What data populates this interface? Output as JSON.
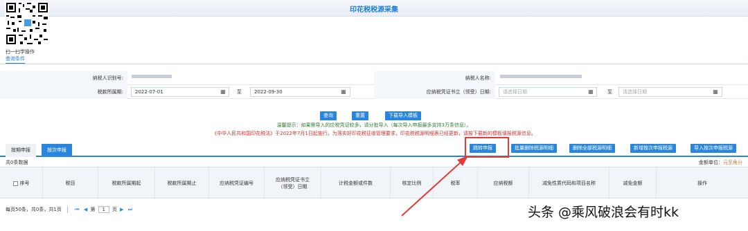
{
  "header": {
    "title": "印花税税源采集"
  },
  "qr": {
    "label": "扫一扫学操作"
  },
  "query": {
    "section_tab": "查询条件",
    "taxpayer_id_label": "纳税人识别号:",
    "taxpayer_name_label": "纳税人名称:",
    "period_label": "税款所属期:",
    "period_start": "2022-07-01",
    "period_end": "2022-09-30",
    "to": "至",
    "voucher_date_label": "应纳税凭证书立（领受）日期:",
    "date_placeholder": "请选择日期"
  },
  "actions": {
    "query": "查询",
    "reset": "重置",
    "download_template": "下载导入模板"
  },
  "tips": {
    "line1": "温馨提示：如果需导入的应税凭证较多，请分批导入（每次导入申报最多支持3万条信息）。",
    "line2": "《中华人民共和国印花税法》于2022年7月1日起施行。为落实好印花税征收管理要求，印花税税源明细表已经更新，请按下载新的模板填报税源信息。"
  },
  "tabs": {
    "by_period": "按期申报",
    "by_item": "按次申报"
  },
  "toolbar": {
    "jump": "跳转申报",
    "batch_delete": "批量删除税源明细",
    "delete_all": "删除全部税源明细",
    "add_item": "新增按次申报税源",
    "import_item": "导入按次申报税源"
  },
  "table": {
    "count": "共0条数据",
    "unit_label": "金额单位：",
    "unit_value": "元至角分",
    "columns": [
      "序号",
      "税目",
      "税款所属期起",
      "税款所属期止",
      "应纳税凭证编号",
      "应纳税凭证书立（领受）日期",
      "计税金额或件数",
      "核定比例",
      "税率",
      "应纳税额",
      "减免性质代码和项目名称",
      "减免金额",
      "操作"
    ]
  },
  "pager": {
    "summary": "每页50条，共0条，共1页",
    "page_prefix": "第",
    "page_value": "1",
    "page_suffix": "页"
  },
  "watermark": "头条 @乘风破浪会有时kk"
}
